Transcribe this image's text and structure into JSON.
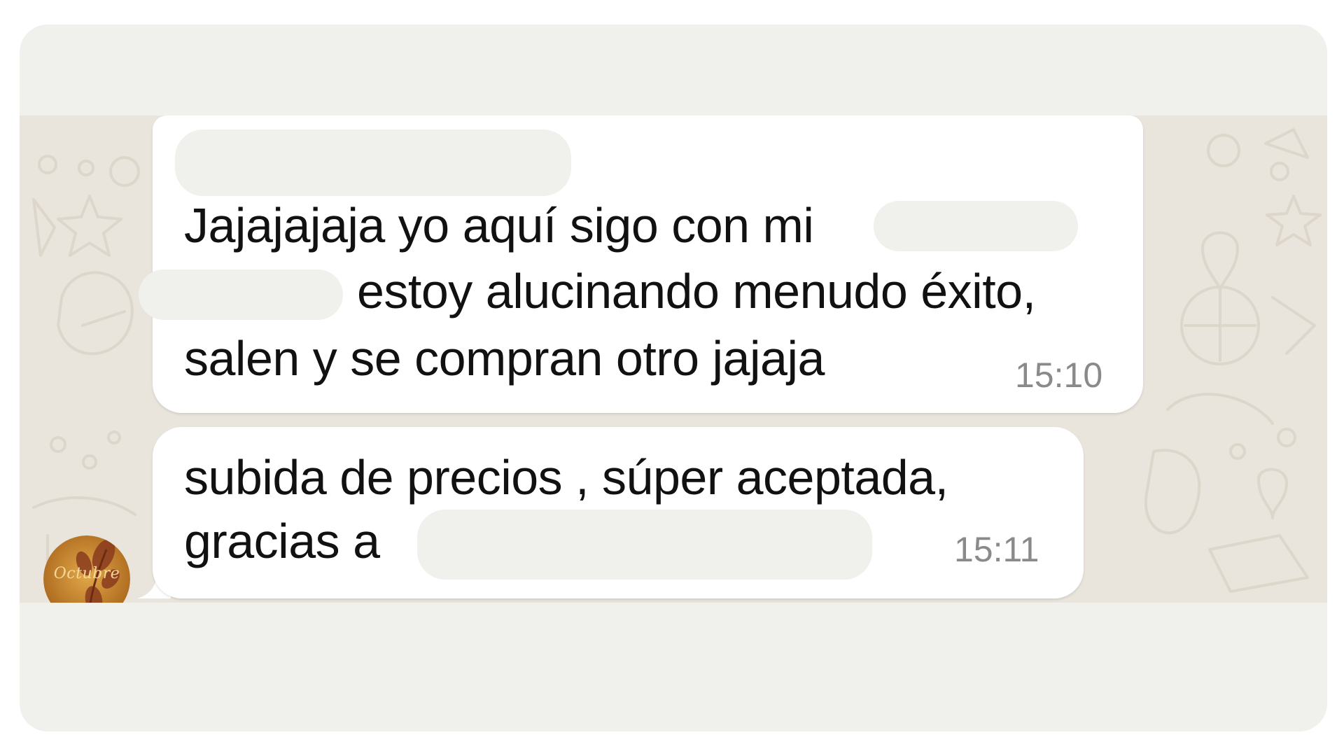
{
  "messages": [
    {
      "lines": [
        "Jajajajaja yo aquí sigo con mi",
        "estoy alucinando menudo éxito,",
        "salen y se compran otro jajaja"
      ],
      "time": "15:10"
    },
    {
      "lines": [
        "subida de precios , súper aceptada,",
        "gracias a"
      ],
      "time": "15:11"
    }
  ],
  "avatar": {
    "label": "Octubre",
    "icon": "leaf-logo-icon",
    "colors": {
      "bg": "#c9892a",
      "leaf": "#8a3b1e"
    }
  },
  "colors": {
    "card_bg": "#f0f0ed",
    "chat_bg": "#e9e4dc",
    "bubble": "#ffffff",
    "timestamp": "#8a8a8a",
    "sender_accent": "#e06a22"
  }
}
